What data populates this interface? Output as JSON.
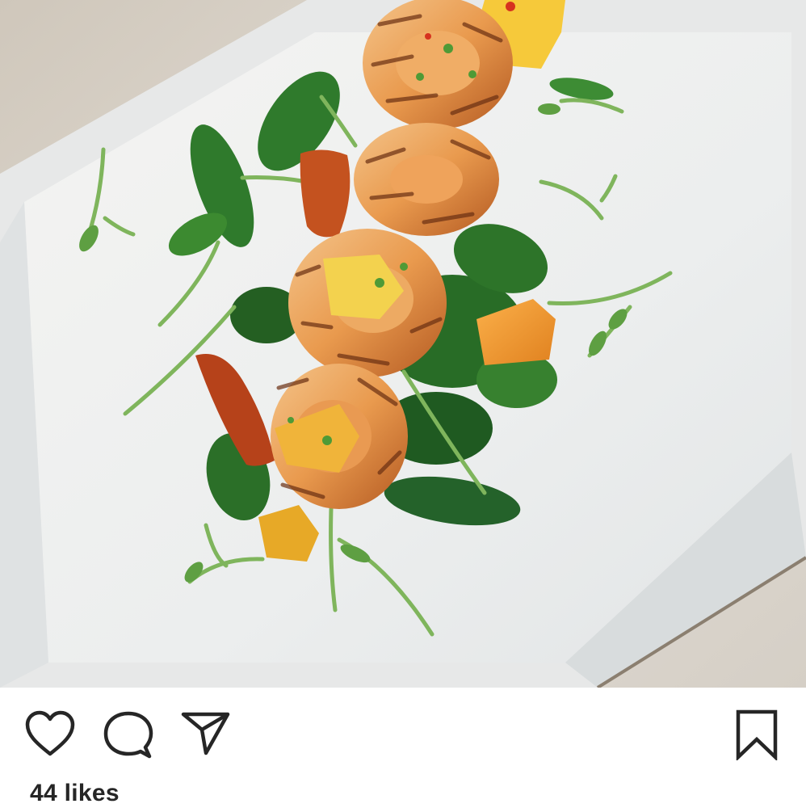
{
  "post": {
    "image_subject": "grilled-shrimp-arugula-mango-salad",
    "likes_label": "44 likes"
  },
  "actions": {
    "like_icon": "heart-outline-icon",
    "comment_icon": "speech-bubble-outline-icon",
    "share_icon": "paper-plane-outline-icon",
    "save_icon": "bookmark-outline-icon"
  },
  "colors": {
    "icon_stroke": "#262626",
    "text": "#262626",
    "background": "#ffffff"
  }
}
